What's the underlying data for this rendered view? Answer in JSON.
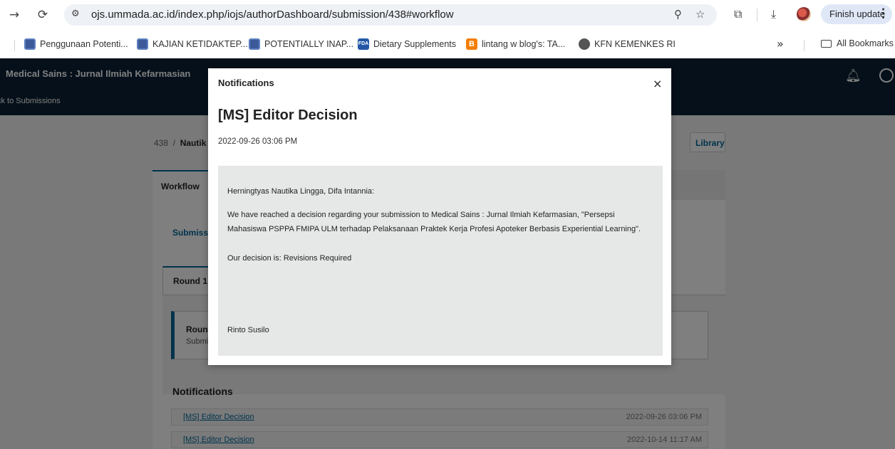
{
  "browser": {
    "url": "ojs.ummada.ac.id/index.php/iojs/authorDashboard/submission/438#workflow",
    "finish_update_label": "Finish update",
    "bookmarks": [
      {
        "label": "Penggunaan Potenti...",
        "favicon": "globe-icon"
      },
      {
        "label": "KAJIAN KETIDAKTEP...",
        "favicon": "globe-icon"
      },
      {
        "label": "POTENTIALLY INAP...",
        "favicon": "globe-icon"
      },
      {
        "label": "Dietary Supplements",
        "favicon": "fda-icon"
      },
      {
        "label": "lintang w blog's: TA...",
        "favicon": "blogger-icon"
      },
      {
        "label": "KFN KEMENKES RI",
        "favicon": "kfn-icon"
      }
    ],
    "more_bookmarks": "»",
    "all_bookmarks_label": "All Bookmarks"
  },
  "header": {
    "site_title": "Medical Sains : Jurnal Ilmiah Kefarmasian",
    "back_link": "ck to Submissions"
  },
  "dashboard": {
    "breadcrumb_id": "438",
    "breadcrumb_sep": "/",
    "breadcrumb_title": "Nautik",
    "library_label": "Library",
    "tab_workflow": "Workflow",
    "subtab_submission": "Submissio",
    "round_tab": "Round 1",
    "round_notice_title": "Round",
    "round_notice_sub": "Submi",
    "notifications_heading": "Notifications",
    "notifications": [
      {
        "label": "[MS] Editor Decision",
        "date": "2022-09-26 03:06 PM"
      },
      {
        "label": "[MS] Editor Decision",
        "date": "2022-10-14 11:17 AM"
      }
    ]
  },
  "modal": {
    "title": "Notifications",
    "close": "×",
    "heading": "[MS] Editor Decision",
    "date": "2022-09-26 03:06 PM",
    "greeting": "Herningtyas Nautika Lingga, Difa Intannia:",
    "body_line1": "We have reached a decision regarding your submission to Medical Sains : Jurnal Ilmiah Kefarmasian, \"Persepsi",
    "body_line2": "Mahasiswa PSPPA FMIPA ULM terhadap Pelaksanaan Praktek Kerja Profesi Apoteker Berbasis Experiential Learning\".",
    "decision": "Our decision is: Revisions Required",
    "signature": "Rinto Susilo"
  },
  "colors": {
    "header_bg": "#0b2035",
    "link": "#006798",
    "overlay": "rgba(0,0,0,0.5)"
  }
}
